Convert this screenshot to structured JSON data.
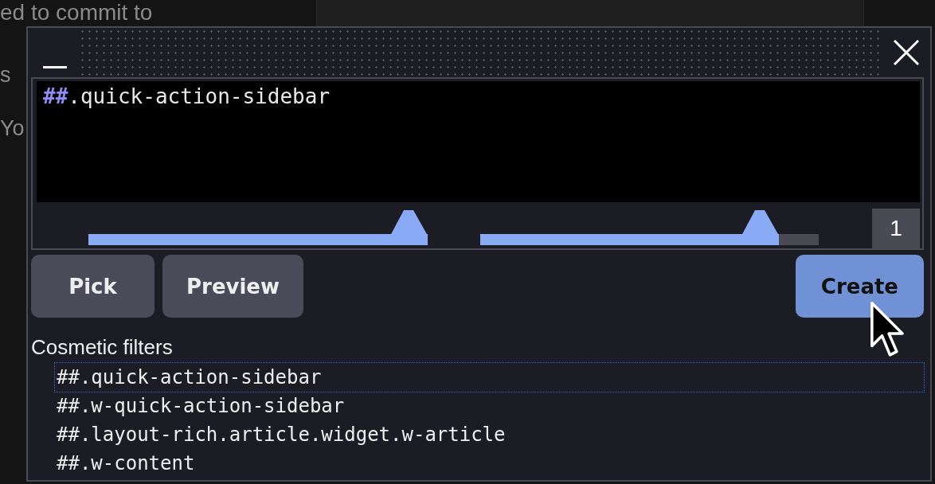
{
  "background_page": {
    "lines": [
      "ed to commit to",
      "s",
      "Yo"
    ]
  },
  "picker": {
    "filter_input": {
      "tokens": [
        {
          "text": "##",
          "kind": "operator"
        },
        {
          "text": ".quick-action-sidebar",
          "kind": "selector"
        }
      ]
    },
    "sliders": [
      {
        "level": 1
      },
      {
        "level": 0.88
      }
    ],
    "match_count": "1",
    "buttons": [
      {
        "label": "Pick",
        "kind": "secondary"
      },
      {
        "label": "Preview",
        "kind": "secondary"
      },
      {
        "label": "Create",
        "kind": "primary"
      }
    ],
    "cosmetic_filters": {
      "title": "Cosmetic filters",
      "items": [
        {
          "text": "##.quick-action-sidebar",
          "selected": true
        },
        {
          "text": "##.w-quick-action-sidebar",
          "selected": false
        },
        {
          "text": "##.layout-rich.article.widget.w-article",
          "selected": false
        },
        {
          "text": "##.w-content",
          "selected": false
        }
      ]
    }
  }
}
